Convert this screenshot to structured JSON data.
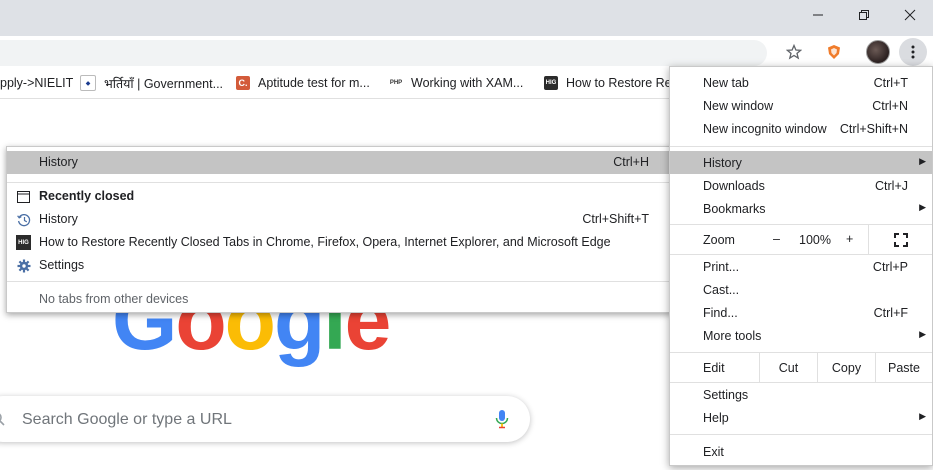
{
  "window": {
    "minimize_glyph": "—",
    "restore_glyph": "❐",
    "close_glyph": "✕"
  },
  "toolbar": {
    "bookmark_star_icon": "star-icon",
    "extension_icon": "shield-extension-icon",
    "menu_icon": "three-dots-icon"
  },
  "bookmarks": [
    {
      "label": "pply->NIELIT",
      "icon": ""
    },
    {
      "label": "भर्तियाँ | Government...",
      "icon": "nielit-logo"
    },
    {
      "label": "Aptitude test for m...",
      "icon": "C."
    },
    {
      "label": "Working with XAM...",
      "icon": "PHP"
    },
    {
      "label": "How to Restore Rec",
      "icon": "HIG"
    }
  ],
  "history_submenu": {
    "header": {
      "label": "History",
      "shortcut": "Ctrl+H"
    },
    "recently_closed": "Recently closed",
    "items": [
      {
        "label": "History",
        "shortcut": "Ctrl+Shift+T",
        "icon": "history-clock-icon"
      },
      {
        "label": "How to Restore Recently Closed Tabs in Chrome, Firefox, Opera, Internet Explorer, and Microsoft Edge",
        "shortcut": "",
        "icon": "HIG"
      },
      {
        "label": "Settings",
        "shortcut": "",
        "icon": "gear-icon"
      }
    ],
    "footer": "No tabs from other devices"
  },
  "main_menu": {
    "new_tab": {
      "label": "New tab",
      "shortcut": "Ctrl+T"
    },
    "new_window": {
      "label": "New window",
      "shortcut": "Ctrl+N"
    },
    "new_incognito": {
      "label": "New incognito window",
      "shortcut": "Ctrl+Shift+N"
    },
    "history": {
      "label": "History"
    },
    "downloads": {
      "label": "Downloads",
      "shortcut": "Ctrl+J"
    },
    "bookmarks": {
      "label": "Bookmarks"
    },
    "zoom": {
      "label": "Zoom",
      "minus": "–",
      "value": "100%",
      "plus": "+"
    },
    "print": {
      "label": "Print...",
      "shortcut": "Ctrl+P"
    },
    "cast": {
      "label": "Cast..."
    },
    "find": {
      "label": "Find...",
      "shortcut": "Ctrl+F"
    },
    "more_tools": {
      "label": "More tools"
    },
    "edit": {
      "label": "Edit",
      "cut": "Cut",
      "copy": "Copy",
      "paste": "Paste"
    },
    "settings": {
      "label": "Settings"
    },
    "help": {
      "label": "Help"
    },
    "exit": {
      "label": "Exit"
    }
  },
  "page": {
    "logo_letters": [
      "G",
      "o",
      "o",
      "g",
      "l",
      "e"
    ],
    "logo_colors": [
      "#4285f4",
      "#ea4335",
      "#fbbc05",
      "#4285f4",
      "#34a853",
      "#ea4335"
    ],
    "search_placeholder": "Search Google or type a URL"
  },
  "colors": {
    "highlight": "#c4c4c4",
    "titlebar": "#dee1e6",
    "omnibox": "#f1f3f4"
  }
}
